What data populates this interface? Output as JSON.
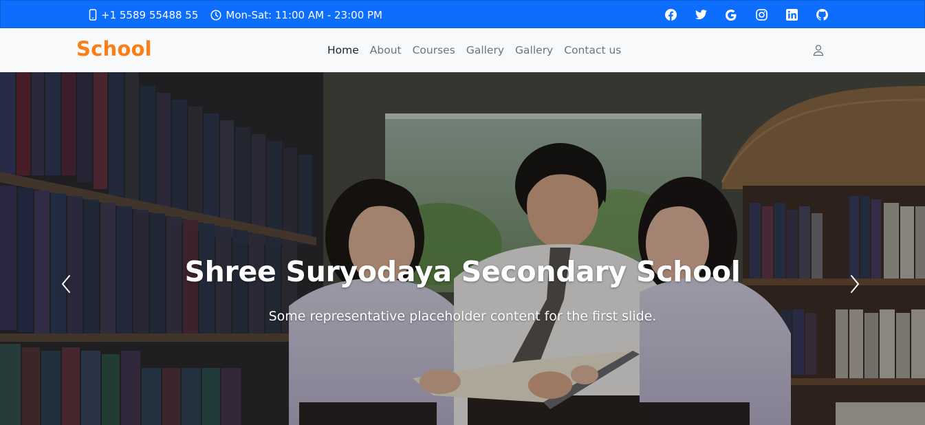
{
  "topbar": {
    "phone": "+1 5589 55488 55",
    "hours": "Mon-Sat: 11:00 AM - 23:00 PM",
    "social_icons": [
      "facebook-icon",
      "twitter-icon",
      "google-icon",
      "instagram-icon",
      "linkedin-icon",
      "github-icon"
    ]
  },
  "navbar": {
    "brand": "School",
    "links": [
      {
        "label": "Home",
        "active": true
      },
      {
        "label": "About"
      },
      {
        "label": "Courses"
      },
      {
        "label": "Gallery"
      },
      {
        "label": "Gallery"
      },
      {
        "label": "Contact us"
      }
    ],
    "user_icon": "user-icon"
  },
  "hero": {
    "title": "Shree Suryodaya Secondary School",
    "text": "Some representative placeholder content for the first slide.",
    "prev_icon": "chevron-left-icon",
    "next_icon": "chevron-right-icon"
  },
  "colors": {
    "topbar": "#0d6efd",
    "brand": "#fd7e14",
    "navbar_bg": "#f8f9fa"
  }
}
